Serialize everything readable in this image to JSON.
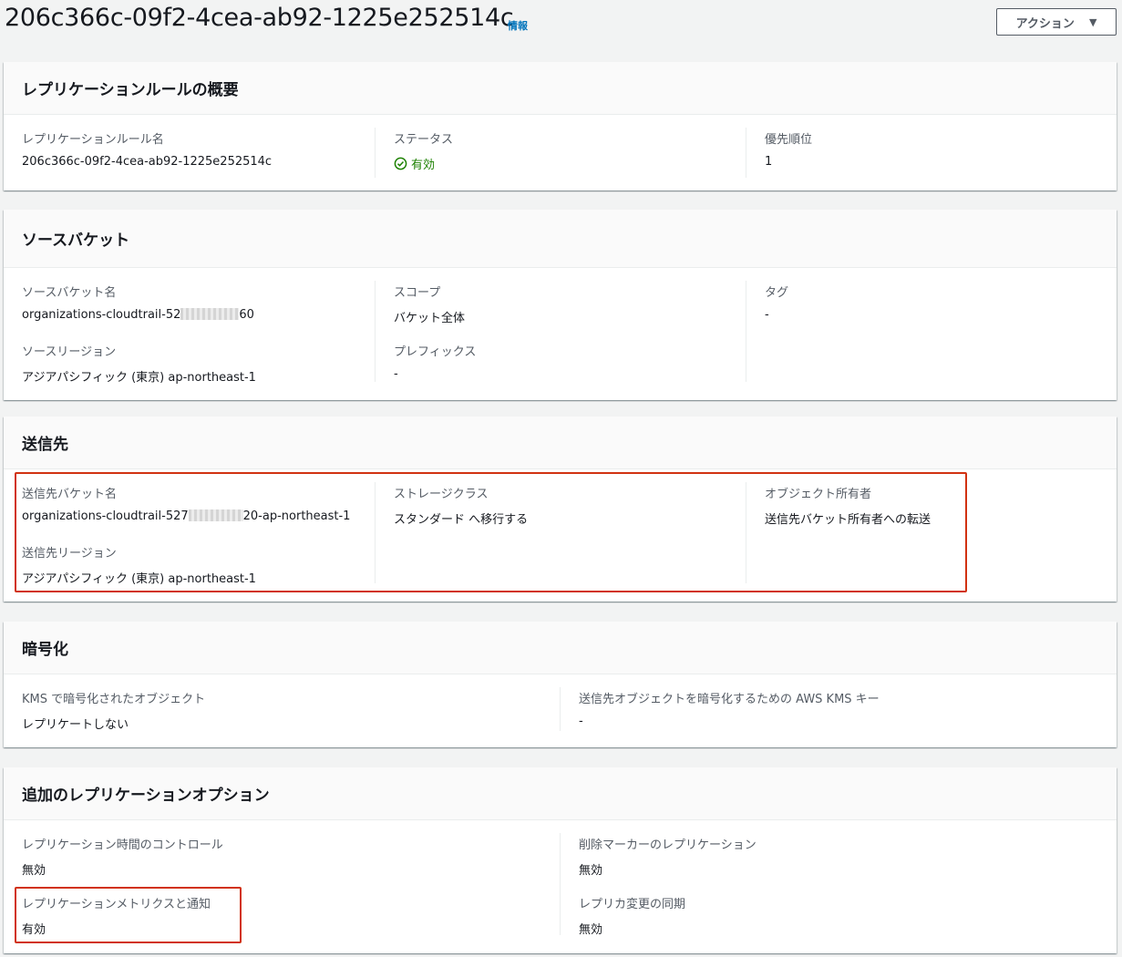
{
  "header": {
    "title": "206c366c-09f2-4cea-ab92-1225e252514c",
    "info": "情報",
    "actions_label": "アクション",
    "actions_caret": "▼"
  },
  "overview": {
    "title": "レプリケーションルールの概要",
    "rule_name_label": "レプリケーションルール名",
    "rule_name_value": "206c366c-09f2-4cea-ab92-1225e252514c",
    "status_label": "ステータス",
    "status_value": "有効",
    "priority_label": "優先順位",
    "priority_value": "1"
  },
  "source": {
    "title": "ソースバケット",
    "bucket_name_label": "ソースバケット名",
    "bucket_name_prefix": "organizations-cloudtrail-52",
    "bucket_name_suffix": "60",
    "region_label": "ソースリージョン",
    "region_value": "アジアパシフィック (東京) ap-northeast-1",
    "scope_label": "スコープ",
    "scope_value": "バケット全体",
    "prefix_label": "プレフィックス",
    "prefix_value": "-",
    "tags_label": "タグ",
    "tags_value": "-"
  },
  "destination": {
    "title": "送信先",
    "bucket_name_label": "送信先バケット名",
    "bucket_name_prefix": "organizations-cloudtrail-527",
    "bucket_name_suffix": "20-ap-northeast-1",
    "region_label": "送信先リージョン",
    "region_value": "アジアパシフィック (東京) ap-northeast-1",
    "storage_class_label": "ストレージクラス",
    "storage_class_value": "スタンダード へ移行する",
    "owner_label": "オブジェクト所有者",
    "owner_value": "送信先バケット所有者への転送"
  },
  "encryption": {
    "title": "暗号化",
    "kms_objects_label": "KMS で暗号化されたオブジェクト",
    "kms_objects_value": "レプリケートしない",
    "kms_key_label": "送信先オブジェクトを暗号化するための AWS KMS キー",
    "kms_key_value": "-"
  },
  "options": {
    "title": "追加のレプリケーションオプション",
    "rtc_label": "レプリケーション時間のコントロール",
    "rtc_value": "無効",
    "metrics_label": "レプリケーションメトリクスと通知",
    "metrics_value": "有効",
    "delete_marker_label": "削除マーカーのレプリケーション",
    "delete_marker_value": "無効",
    "replica_sync_label": "レプリカ変更の同期",
    "replica_sync_value": "無効"
  },
  "colors": {
    "highlight": "#d13212",
    "status_ok": "#1d8102",
    "link": "#0073bb"
  }
}
